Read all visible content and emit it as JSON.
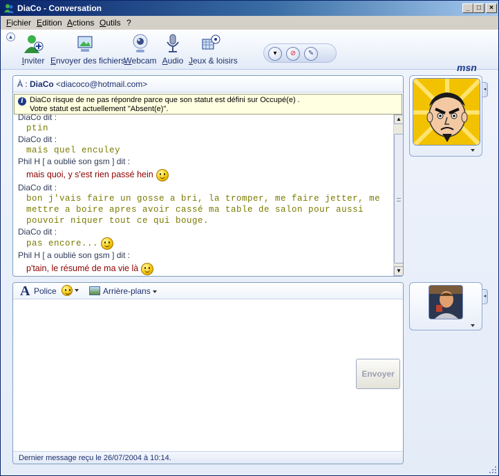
{
  "window": {
    "title": "DiaCo - Conversation",
    "controls": {
      "minimize": "_",
      "maximize": "□",
      "close": "×"
    }
  },
  "menu": {
    "items": [
      {
        "label": "Fichier"
      },
      {
        "label": "Edition"
      },
      {
        "label": "Actions"
      },
      {
        "label": "Outils"
      },
      {
        "label": "?"
      }
    ]
  },
  "toolbar": {
    "items": [
      {
        "label": "Inviter",
        "icon": "invite-user-icon"
      },
      {
        "label": "Envoyer des fichiers",
        "icon": "send-files-icon"
      },
      {
        "label": "Webcam",
        "icon": "webcam-icon"
      },
      {
        "label": "Audio",
        "icon": "microphone-icon"
      },
      {
        "label": "Jeux & loisirs",
        "icon": "games-icon"
      }
    ],
    "side_buttons": [
      {
        "glyph": "▾",
        "icon": "options-icon"
      },
      {
        "glyph": "⊘",
        "icon": "block-icon"
      },
      {
        "glyph": "✎",
        "icon": "brush-icon"
      }
    ],
    "brand": "msn"
  },
  "conversation": {
    "to_label": "À :",
    "contact_name": "DiaCo",
    "contact_email": "<diacoco@hotmail.com>",
    "info": {
      "line1": "DiaCo risque de ne pas répondre parce que son statut est défini sur Occupé(e) .",
      "line2": "Votre statut est actuellement \"Absent(e)\"."
    },
    "messages": [
      {
        "who": "DiaCo dit :",
        "text": "ptin",
        "style": "diaco",
        "smiley": false
      },
      {
        "who": "DiaCo dit :",
        "text": "mais quel enculey",
        "style": "diaco",
        "smiley": false
      },
      {
        "who": "Phil H [ a oublié son gsm ] dit :",
        "text": "mais quoi, y s'est rien passé hein",
        "style": "phil",
        "smiley": true
      },
      {
        "who": "DiaCo dit :",
        "text": "bon j'vais faire un gosse a bri, la tromper, me faire jetter, me mettre a boire apres avoir cassé ma table de salon pour aussi pouvoir niquer tout ce qui bouge.",
        "style": "diaco",
        "smiley": false
      },
      {
        "who": "DiaCo dit :",
        "text": "pas encore...",
        "style": "diaco",
        "smiley": true
      },
      {
        "who": "Phil H [ a oublié son gsm ] dit :",
        "text": "p'tain, le résumé de ma vie là",
        "style": "phil",
        "smiley": true
      }
    ]
  },
  "compose": {
    "font_label": "Police",
    "backgrounds_label": "Arrière-plans",
    "send_label": "Envoyer",
    "input_value": "",
    "status": "Dernier message reçu le 26/07/2004 à 10:14."
  },
  "colors": {
    "title_start": "#0a246a",
    "title_end": "#a6caf0",
    "diaco_text": "#7a7a00",
    "phil_text": "#8b0000",
    "avatar_bg": "#f2c200"
  }
}
